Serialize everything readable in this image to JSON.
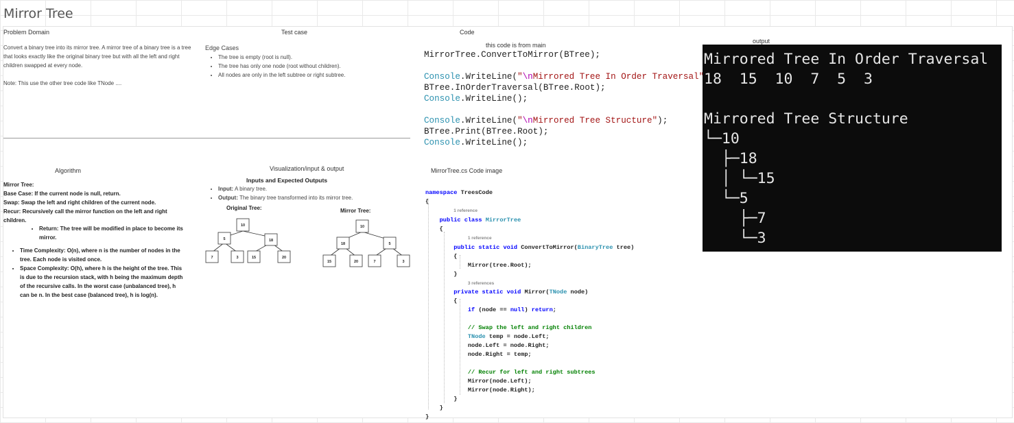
{
  "page": {
    "title": "Mirror Tree"
  },
  "sections": {
    "problem_domain": "Problem Domain",
    "test_case": "Test case",
    "code": "Code",
    "output": "output",
    "algorithm": "Algorithm",
    "visualization": "Visualization/input & output",
    "code_image": "MirrorTree.cs Code image",
    "code_note": "this code is from main"
  },
  "problem": {
    "description": "Convert a binary tree into its mirror tree. A mirror tree of a binary tree is a tree that looks exactly like the original binary tree but with all the left and right children swapped at every node.",
    "note": "Note: This use the other tree code like TNode ...."
  },
  "edge_cases": {
    "title": "Edge Cases",
    "items": [
      "The tree is empty (root is null).",
      "The tree has only one node (root without children).",
      "All nodes are only in the left subtree or right subtree."
    ]
  },
  "algorithm": {
    "lines": [
      "Mirror Tree:",
      "Base Case: If the current node is null, return.",
      "Swap: Swap the left and right children of the current node.",
      "Recur: Recursively call the mirror function on the left and right children."
    ],
    "return_item": "Return: The tree will be modified in place to become its mirror.",
    "complexity": [
      "Time Complexity: O(n), where n is the number of nodes in the tree. Each node is visited once.",
      "Space Complexity: O(h), where h is the height of the tree. This is due to the recursion stack, with h being the maximum depth of the recursive calls. In the worst case (unbalanced tree), h can be n. In the best case (balanced tree), h is log(n)."
    ]
  },
  "io": {
    "title": "Inputs and Expected Outputs",
    "input_label": "Input:",
    "input_text": "A binary tree.",
    "output_label": "Output:",
    "output_text": "The binary tree transformed into its mirror tree."
  },
  "trees": {
    "original_label": "Original Tree:",
    "mirror_label": "Mirror Tree:",
    "original": {
      "root": "10",
      "l": "5",
      "r": "18",
      "ll": "7",
      "lr": "3",
      "rl": "15",
      "rr": "20"
    },
    "mirror": {
      "root": "10",
      "l": "18",
      "r": "5",
      "ll": "15",
      "lr": "20",
      "rl": "7",
      "rr": "3"
    }
  },
  "main_code": {
    "l1_obj": "MirrorTree",
    "l1_method": "ConvertToMirror",
    "l1_arg": "BTree",
    "console": "Console",
    "writeline": "WriteLine",
    "esc": "\\n",
    "s1": "Mirrored Tree In Order Traversal",
    "btree": "BTree",
    "inorder": "InOrderTraversal",
    "root": "Root",
    "s2": "Mirrored Tree Structure",
    "print": "Print"
  },
  "class_code": {
    "namespace_kw": "namespace",
    "namespace_name": "TreesCode",
    "ref1": "1 reference",
    "class_mods": "public class",
    "class_name": "MirrorTree",
    "ref2": "1 reference",
    "m1_mods": "public static void",
    "m1_name": "ConvertToMirror",
    "m1_ptype": "BinaryTree",
    "m1_pname": "tree",
    "m1_call": "Mirror(tree.Root);",
    "ref3": "3 references",
    "m2_mods": "private static void",
    "m2_name": "Mirror",
    "m2_ptype": "TNode",
    "m2_pname": "node",
    "if_kw": "if",
    "if_cond": "(node == ",
    "null_kw": "null",
    "if_close": ") ",
    "return_kw": "return",
    "semi": ";",
    "comment1": "// Swap the left and right children",
    "tnode_type": "TNode",
    "swap1": "temp = node.Left;",
    "swap2": "node.Left = node.Right;",
    "swap3": "node.Right = temp;",
    "comment2": "// Recur for left and right subtrees",
    "rec1": "Mirror(node.Left);",
    "rec2": "Mirror(node.Right);"
  },
  "console_output": {
    "line1": "Mirrored Tree In Order Traversal",
    "line2": "18  15  10  7  5  3",
    "line3": "Mirrored Tree Structure",
    "line4": "└─10",
    "line5": "  ├─18",
    "line6": "  │ └─15",
    "line7": "  └─5",
    "line8": "    ├─7",
    "line9": "    └─3"
  }
}
